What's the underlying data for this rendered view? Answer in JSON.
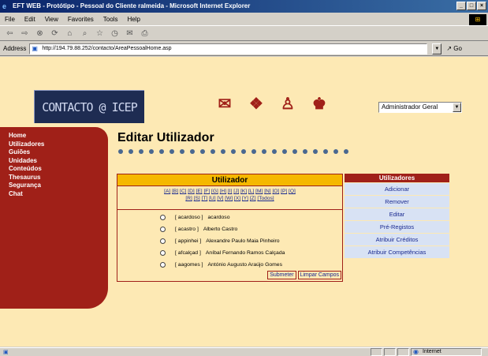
{
  "window": {
    "title": "EFT WEB - Protótipo - Pessoal do Cliente ralmeida - Microsoft Internet Explorer",
    "controls": [
      "_",
      "□",
      "×"
    ]
  },
  "menu": [
    "File",
    "Edit",
    "View",
    "Favorites",
    "Tools",
    "Help"
  ],
  "address": {
    "label": "Address",
    "url": "http://194.79.88.252/contacto/AreaPessoalHome.asp",
    "go": "Go"
  },
  "logo": "CONTACTO @ ICEP",
  "profile": "Administrador Geral",
  "nav": [
    "Home",
    "Utilizadores",
    "Guiões",
    "Unidades",
    "Conteúdos",
    "Thesaurus",
    "Segurança",
    "Chat"
  ],
  "page_title": "Editar Utilizador",
  "panel": {
    "title": "Utilizador",
    "letters_row1": [
      "[A]",
      "[B]",
      "[C]",
      "[D]",
      "[E]",
      "[F]",
      "[G]",
      "[H]",
      "[I]",
      "[J]",
      "[K]",
      "[L]",
      "[M]",
      "[N]",
      "[O]",
      "[P]",
      "[Q]"
    ],
    "letters_row2": [
      "[R]",
      "[S]",
      "[T]",
      "[U]",
      "[V]",
      "[W]",
      "[X]",
      "[Y]",
      "[Z]",
      "[Todos]"
    ],
    "users": [
      {
        "login": "[ acardoso ]",
        "name": "acardoso"
      },
      {
        "login": "[ acastro ]",
        "name": "Alberto Castro"
      },
      {
        "login": "[ appinhei ]",
        "name": "Alexandre Paulo Maia Pinheiro"
      },
      {
        "login": "[ afcalçad ]",
        "name": "Aníbal Fernando Ramos Calçada"
      },
      {
        "login": "[ aagomes ]",
        "name": "António Augusto Araújo Gomes"
      }
    ],
    "submit": "Submeter",
    "clear": "Limpar Campos"
  },
  "actions": {
    "title": "Utilizadores",
    "items": [
      "Adicionar",
      "Remover",
      "Editar",
      "Pré-Registos",
      "Atribuir Créditos",
      "Atribuir Competências"
    ]
  },
  "status": {
    "zone": "Internet"
  }
}
